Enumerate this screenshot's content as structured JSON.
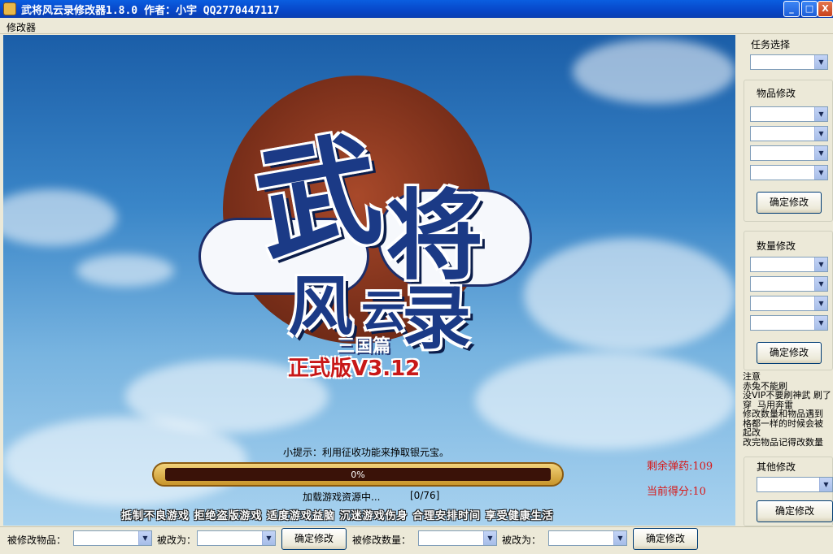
{
  "window": {
    "title": "武将风云录修改器1.8.0 作者：小宇 QQ2770447117",
    "buttons": {
      "minimize": "_",
      "maximize": "□",
      "close": "X"
    }
  },
  "menu": {
    "items": [
      {
        "label": "修改器"
      }
    ]
  },
  "game": {
    "logo_text": {
      "c1": "武",
      "c2": "将",
      "c3": "风",
      "c4": "云",
      "c5": "录",
      "subtitle": "三国篇"
    },
    "version": "正式版V3.12",
    "tip": "小提示：利用征收功能来挣取银元宝。",
    "progress": {
      "percent_label": "0%",
      "fraction": 0
    },
    "loading_text": "加载游戏资源中...",
    "loading_count": "[0/76]",
    "advice": "抵制不良游戏  拒绝盗版游戏  适度游戏益脑  沉迷游戏伤身  合理安排时间  享受健康生活",
    "ammo_label": "剩余弹药:109",
    "score_label": "当前得分:10",
    "colors": {
      "stat_red": "#d81818",
      "version_red": "#c81818"
    }
  },
  "sidebar": {
    "task": {
      "label": "任务选择",
      "value": ""
    },
    "items": {
      "label": "物品修改",
      "selects": [
        "",
        "",
        "",
        ""
      ],
      "confirm": "确定修改"
    },
    "quantity": {
      "label": "数量修改",
      "selects": [
        "",
        "",
        "",
        ""
      ],
      "confirm": "确定修改"
    },
    "notes": "注意\n赤兔不能刷\n没VIP不要刷神武 刷了\n穿  马用奔雷\n修改数量和物品遇到\n格都一样的时候会被\n起改\n改完物品记得改数量",
    "other": {
      "label": "其他修改",
      "value": "",
      "confirm": "确定修改"
    }
  },
  "bottom": {
    "item_label": "被修改物品：",
    "change_to1": "被改为：",
    "confirm1": "确定修改",
    "qty_label": "被修改数量：",
    "change_to2": "被改为：",
    "confirm2": "确定修改"
  },
  "icons": {
    "app": "app-icon",
    "dropdown": "chevron-down-icon"
  }
}
